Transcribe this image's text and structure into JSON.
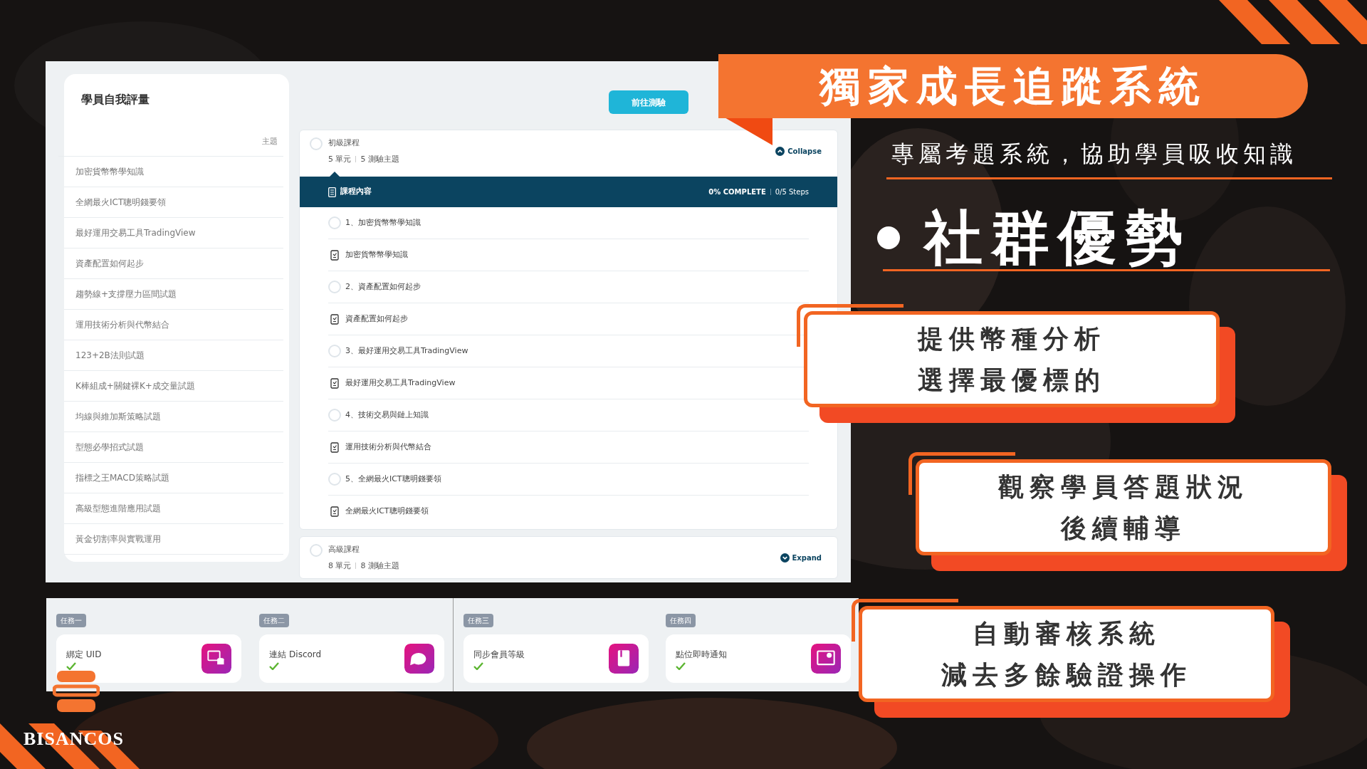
{
  "banner": {
    "title": "獨家成長追蹤系統"
  },
  "subtitle": "專屬考題系統，協助學員吸收知識",
  "heading": "社群優勢",
  "feature_cards": [
    {
      "lines": [
        "提供幣種分析",
        "選擇最優標的"
      ]
    },
    {
      "lines": [
        "觀察學員答題狀況",
        "後續輔導"
      ]
    },
    {
      "lines": [
        "自動審核系統",
        "減去多餘驗證操作"
      ]
    }
  ],
  "self_assessment": {
    "title": "學員自我評量",
    "column_header": "主題",
    "button": "前往測驗",
    "topics": [
      "加密貨幣幣學知識",
      "全網最火ICT聰明錢要領",
      "最好運用交易工具TradingView",
      "資產配置如何起步",
      "趨勢線+支撐壓力區間試題",
      "運用技術分析與代幣結合",
      "123+2B法則試題",
      "K棒組成+關鍵裸K+成交量試題",
      "均線與維加斯策略試題",
      "型態必學招式試題",
      "指標之王MACD策略試題",
      "高級型態進階應用試題",
      "黃金切割率與實戰運用"
    ]
  },
  "courses": [
    {
      "title": "初級課程",
      "units": "5 單元",
      "quizzes": "5 測驗主題",
      "toggle": "Collapse",
      "expanded": true,
      "content": {
        "title": "課程內容",
        "progress": "0% COMPLETE",
        "steps": "0/5 Steps",
        "items": [
          {
            "kind": "lesson",
            "label": "1、加密貨幣幣學知識"
          },
          {
            "kind": "quiz",
            "label": "加密貨幣幣學知識"
          },
          {
            "kind": "lesson",
            "label": "2、資產配置如何起步"
          },
          {
            "kind": "quiz",
            "label": "資產配置如何起步"
          },
          {
            "kind": "lesson",
            "label": "3、最好運用交易工具TradingView"
          },
          {
            "kind": "quiz",
            "label": "最好運用交易工具TradingView"
          },
          {
            "kind": "lesson",
            "label": "4、技術交易與鏈上知識"
          },
          {
            "kind": "quiz",
            "label": "運用技術分析與代幣結合"
          },
          {
            "kind": "lesson",
            "label": "5、全網最火ICT聰明錢要領"
          },
          {
            "kind": "quiz",
            "label": "全網最火ICT聰明錢要領"
          }
        ]
      }
    },
    {
      "title": "高級課程",
      "units": "8 單元",
      "quizzes": "8 測驗主題",
      "toggle": "Expand",
      "expanded": false
    }
  ],
  "tasks": [
    {
      "tag": "任務一",
      "label": "綁定 UID",
      "done": true
    },
    {
      "tag": "任務二",
      "label": "連結 Discord",
      "done": true
    },
    {
      "tag": "任務三",
      "label": "同步會員等級",
      "done": true
    },
    {
      "tag": "任務四",
      "label": "點位即時通知",
      "done": true
    }
  ],
  "brand": {
    "name": "BISANCOS"
  }
}
